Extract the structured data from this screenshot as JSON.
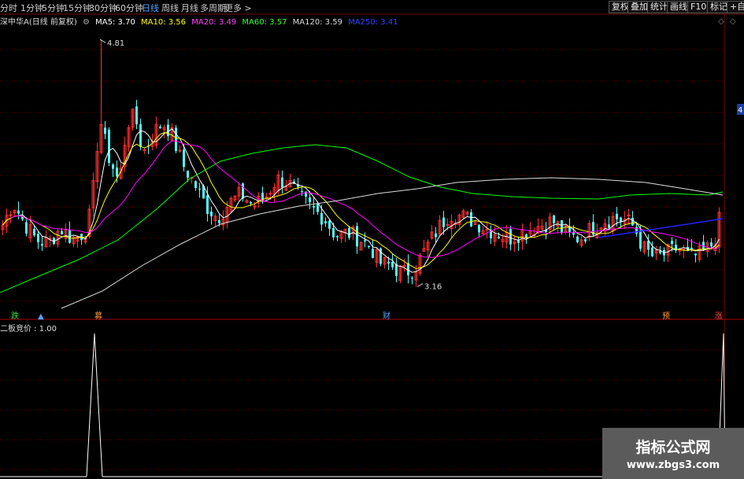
{
  "toolbar": {
    "periods": [
      "分时",
      "1分钟",
      "5分钟",
      "15分钟",
      "30分钟",
      "60分钟",
      "日线",
      "周线",
      "月线",
      "多周期",
      "更多 >"
    ],
    "active_period": "日线",
    "right_buttons": [
      "复权",
      "叠加",
      "统计",
      "画线",
      "F10",
      "标记",
      "+自选"
    ]
  },
  "legend": {
    "stock": "深中华A(日线 前复权)",
    "ma5": "MA5: 3.70",
    "ma10": "MA10: 3.56",
    "ma20": "MA20: 3.49",
    "ma60": "MA60: 3.57",
    "ma120": "MA120: 3.59",
    "ma250": "MA250: 3.41"
  },
  "annotations": {
    "high": "4.81",
    "low": "3.16",
    "right_edge_label": "4"
  },
  "event_markers": [
    {
      "label": "跌",
      "color": "#33dd33"
    },
    {
      "label": "▲",
      "color": "#4aa3ff"
    },
    {
      "label": "募",
      "color": "#ff9933"
    },
    {
      "label": "财",
      "color": "#4aa3ff"
    },
    {
      "label": "预",
      "color": "#ff9933"
    },
    {
      "label": "涨",
      "color": "#ff4444"
    }
  ],
  "indicator": {
    "title": "二板竞价 : 1.00",
    "signals": [
      1,
      1
    ]
  },
  "watermark": {
    "title": "指标公式网",
    "url": "www.zbgs3.com"
  },
  "colors": {
    "up": "#ff3030",
    "down": "#54ffff",
    "ma5": "#ffffff",
    "ma10": "#ffff00",
    "ma20": "#ff00ff",
    "ma60": "#00ff00",
    "ma120": "#dddddd",
    "ma250": "#2222ff",
    "grid": "#5a0000"
  }
}
